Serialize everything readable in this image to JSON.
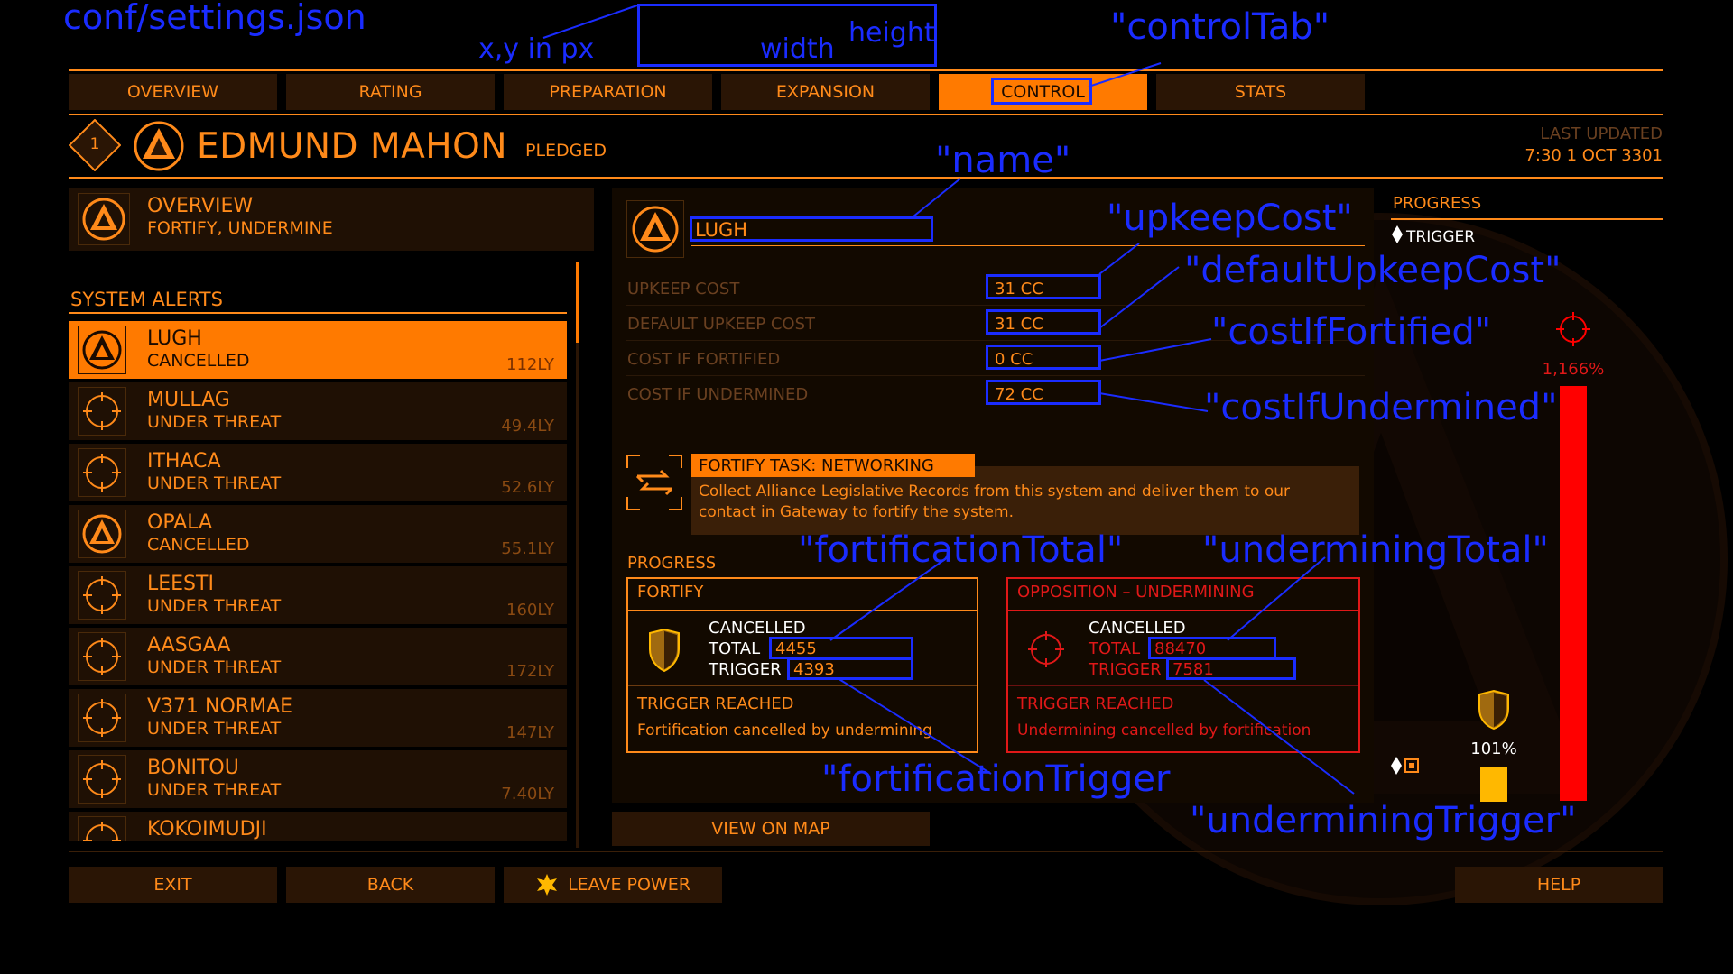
{
  "tabs": [
    {
      "label": "OVERVIEW",
      "active": false
    },
    {
      "label": "RATING",
      "active": false
    },
    {
      "label": "PREPARATION",
      "active": false
    },
    {
      "label": "EXPANSION",
      "active": false
    },
    {
      "label": "CONTROL",
      "active": true
    },
    {
      "label": "STATS",
      "active": false
    }
  ],
  "header": {
    "rank": "1",
    "power_name": "EDMUND MAHON",
    "status": "PLEDGED",
    "last_updated_label": "LAST UPDATED",
    "last_updated_value": "7:30 1 OCT 3301"
  },
  "left": {
    "overview_title": "OVERVIEW",
    "overview_sub": "FORTIFY, UNDERMINE",
    "alerts_heading": "SYSTEM ALERTS",
    "systems": [
      {
        "name": "LUGH",
        "status": "CANCELLED",
        "distance": "112LY",
        "icon": "alliance-icon",
        "selected": true
      },
      {
        "name": "MULLAG",
        "status": "UNDER THREAT",
        "distance": "49.4LY",
        "icon": "crosshair-icon",
        "selected": false
      },
      {
        "name": "ITHACA",
        "status": "UNDER THREAT",
        "distance": "52.6LY",
        "icon": "crosshair-icon",
        "selected": false
      },
      {
        "name": "OPALA",
        "status": "CANCELLED",
        "distance": "55.1LY",
        "icon": "alliance-icon",
        "selected": false
      },
      {
        "name": "LEESTI",
        "status": "UNDER THREAT",
        "distance": "160LY",
        "icon": "crosshair-icon",
        "selected": false
      },
      {
        "name": "AASGAA",
        "status": "UNDER THREAT",
        "distance": "172LY",
        "icon": "crosshair-icon",
        "selected": false
      },
      {
        "name": "V371 NORMAE",
        "status": "UNDER THREAT",
        "distance": "147LY",
        "icon": "crosshair-icon",
        "selected": false
      },
      {
        "name": "BONITOU",
        "status": "UNDER THREAT",
        "distance": "7.40LY",
        "icon": "crosshair-icon",
        "selected": false
      },
      {
        "name": "KOKOIMUDJI",
        "status": "",
        "distance": "",
        "icon": "crosshair-icon",
        "selected": false
      }
    ]
  },
  "detail": {
    "name": "LUGH",
    "costs": [
      {
        "label": "UPKEEP COST",
        "value": "31 CC"
      },
      {
        "label": "DEFAULT UPKEEP COST",
        "value": "31 CC"
      },
      {
        "label": "COST IF FORTIFIED",
        "value": "0 CC"
      },
      {
        "label": "COST IF UNDERMINED",
        "value": "72 CC"
      }
    ],
    "task_title": "FORTIFY TASK: NETWORKING",
    "task_desc": "Collect Alliance Legislative Records from this system and deliver them to our contact in Gateway to fortify the system.",
    "progress_label": "PROGRESS",
    "fortify": {
      "title": "FORTIFY",
      "state": "CANCELLED",
      "total_label": "TOTAL",
      "total": "4455",
      "trigger_label": "TRIGGER",
      "trigger": "4393",
      "reached": "TRIGGER REACHED",
      "message": "Fortification cancelled by undermining"
    },
    "undermine": {
      "title": "OPPOSITION – UNDERMINING",
      "state": "CANCELLED",
      "total_label": "TOTAL",
      "total": "88470",
      "trigger_label": "TRIGGER",
      "trigger": "7581",
      "reached": "TRIGGER REACHED",
      "message": "Undermining cancelled by fortification"
    },
    "view_on_map": "VIEW ON MAP"
  },
  "progress_panel": {
    "title": "PROGRESS",
    "trigger_label": "TRIGGER",
    "undermine_pct": "1,166%",
    "undermine_pct_value": 1166,
    "fortify_pct": "101%",
    "fortify_pct_value": 101
  },
  "footer": {
    "exit": "EXIT",
    "back": "BACK",
    "leave_power": "LEAVE POWER",
    "help": "HELP"
  },
  "annotations": {
    "file": "conf/settings.json",
    "xy": "x,y in px",
    "width": "width",
    "height": "height",
    "controlTab": "\"controlTab\"",
    "name": "\"name\"",
    "upkeepCost": "\"upkeepCost\"",
    "defaultUpkeepCost": "\"defaultUpkeepCost\"",
    "costIfFortified": "\"costIfFortified\"",
    "costIfUndermined": "\"costIfUndermined\"",
    "fortificationTotal": "\"fortificationTotal\"",
    "underminingTotal": "\"underminingTotal\"",
    "fortificationTrigger": "\"fortificationTrigger",
    "underminingTrigger": "\"underminingTrigger\""
  },
  "colors": {
    "accent": "#ff8a1a",
    "accent_active": "#ff7a00",
    "danger": "#ff0000",
    "annotation": "#1a2cff",
    "fortify_bar": "#ffb800"
  }
}
